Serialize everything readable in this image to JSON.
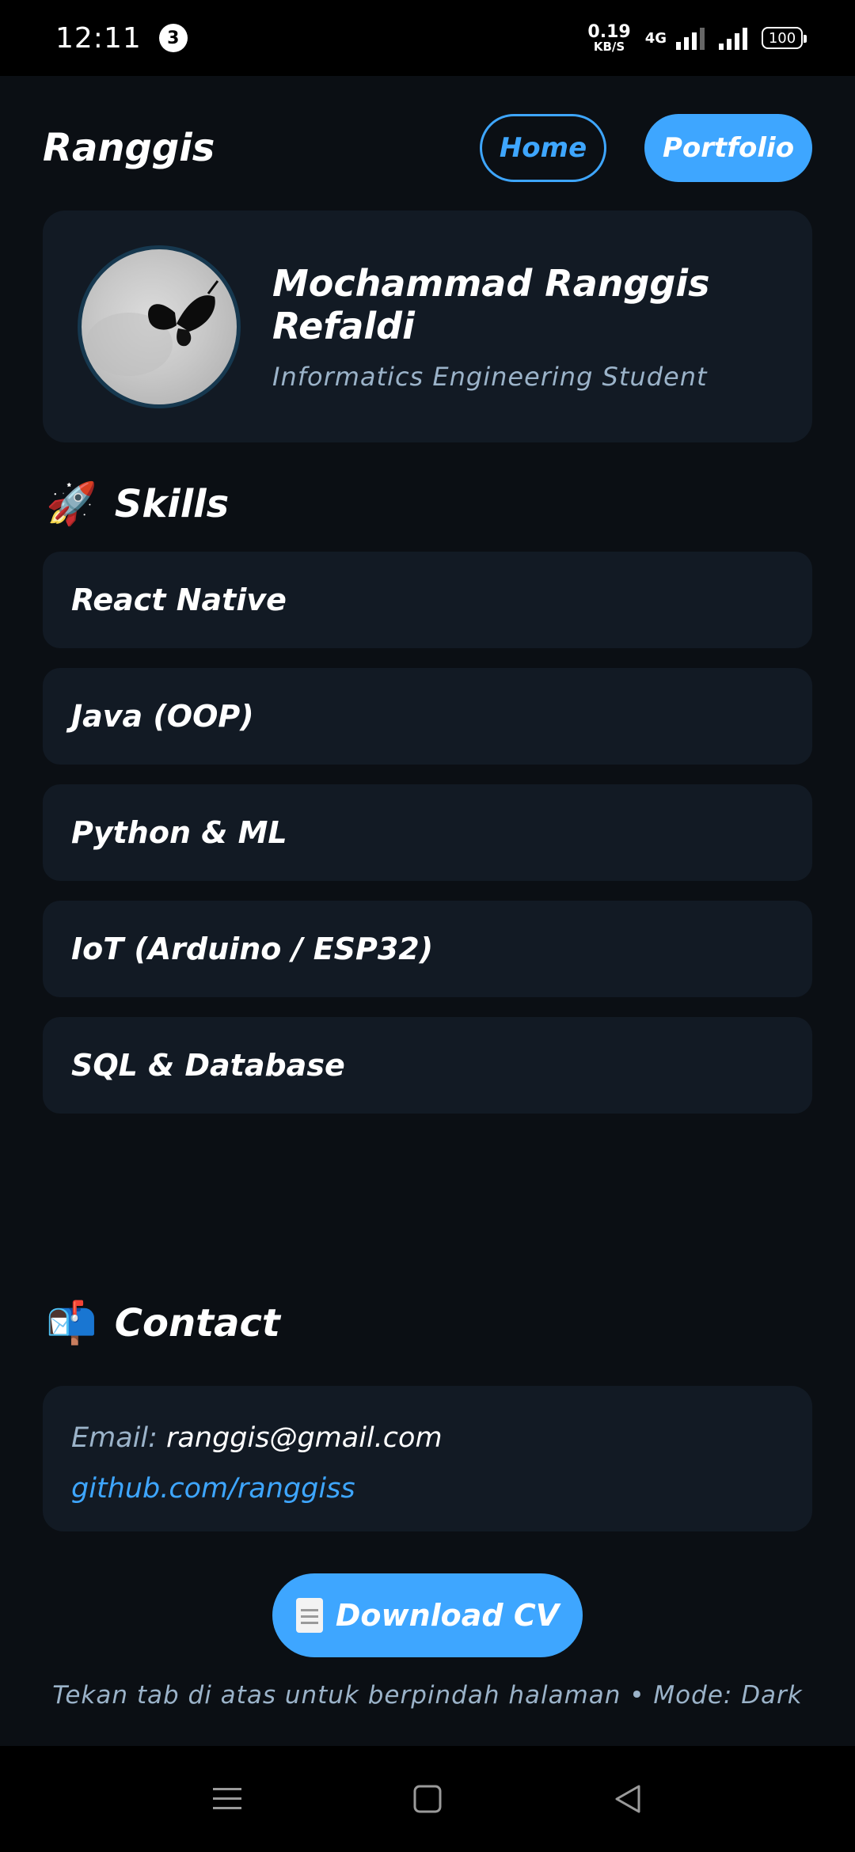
{
  "status_bar": {
    "time": "12:11",
    "notification_count": "3",
    "speed_value": "0.19",
    "speed_unit": "KB/S",
    "network": "4G",
    "battery": "100"
  },
  "header": {
    "brand": "Ranggis",
    "tabs": [
      {
        "label": "Home",
        "active": false
      },
      {
        "label": "Portfolio",
        "active": true
      }
    ]
  },
  "profile": {
    "name": "Mochammad Ranggis Refaldi",
    "role": "Informatics Engineering Student"
  },
  "skills": {
    "emoji": "🚀",
    "title": "Skills",
    "items": [
      "React Native",
      "Java (OOP)",
      "Python & ML",
      "IoT (Arduino / ESP32)",
      "SQL & Database"
    ]
  },
  "contact": {
    "emoji": "📬",
    "title": "Contact",
    "email_label": "Email:",
    "email": "ranggis@gmail.com",
    "github": "github.com/ranggiss"
  },
  "download_button": {
    "label": "Download CV"
  },
  "footer_note": "Tekan tab di atas untuk berpindah halaman • Mode: Dark",
  "colors": {
    "background": "#0b0f14",
    "card": "#121a24",
    "accent": "#3ea6ff",
    "muted_text": "#9bb3c9"
  }
}
